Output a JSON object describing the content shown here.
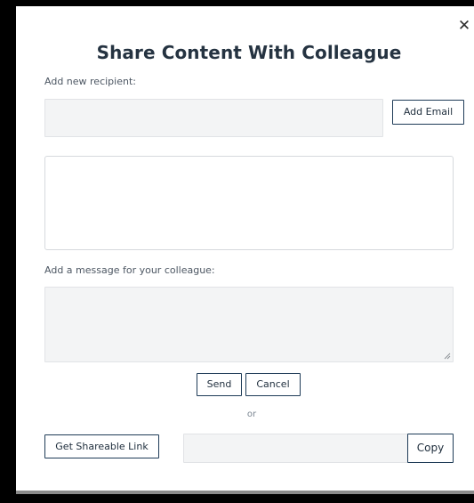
{
  "dialog": {
    "title": "Share Content With Colleague",
    "close_glyph": "✕"
  },
  "recipient": {
    "label": "Add new recipient:",
    "value": "",
    "placeholder": "",
    "add_button": "Add Email"
  },
  "recipients_list": {
    "items": []
  },
  "message": {
    "label": "Add a message for your colleague:",
    "value": "",
    "placeholder": ""
  },
  "actions": {
    "send": "Send",
    "cancel": "Cancel",
    "separator": "or"
  },
  "share_link": {
    "button": "Get Shareable Link",
    "value": "",
    "copy": "Copy"
  },
  "colors": {
    "button_border": "#1e3b57",
    "input_bg": "#f3f4f5",
    "title": "#253341"
  },
  "icons": {
    "close": "close-icon",
    "resize": "resize-grip-icon"
  }
}
